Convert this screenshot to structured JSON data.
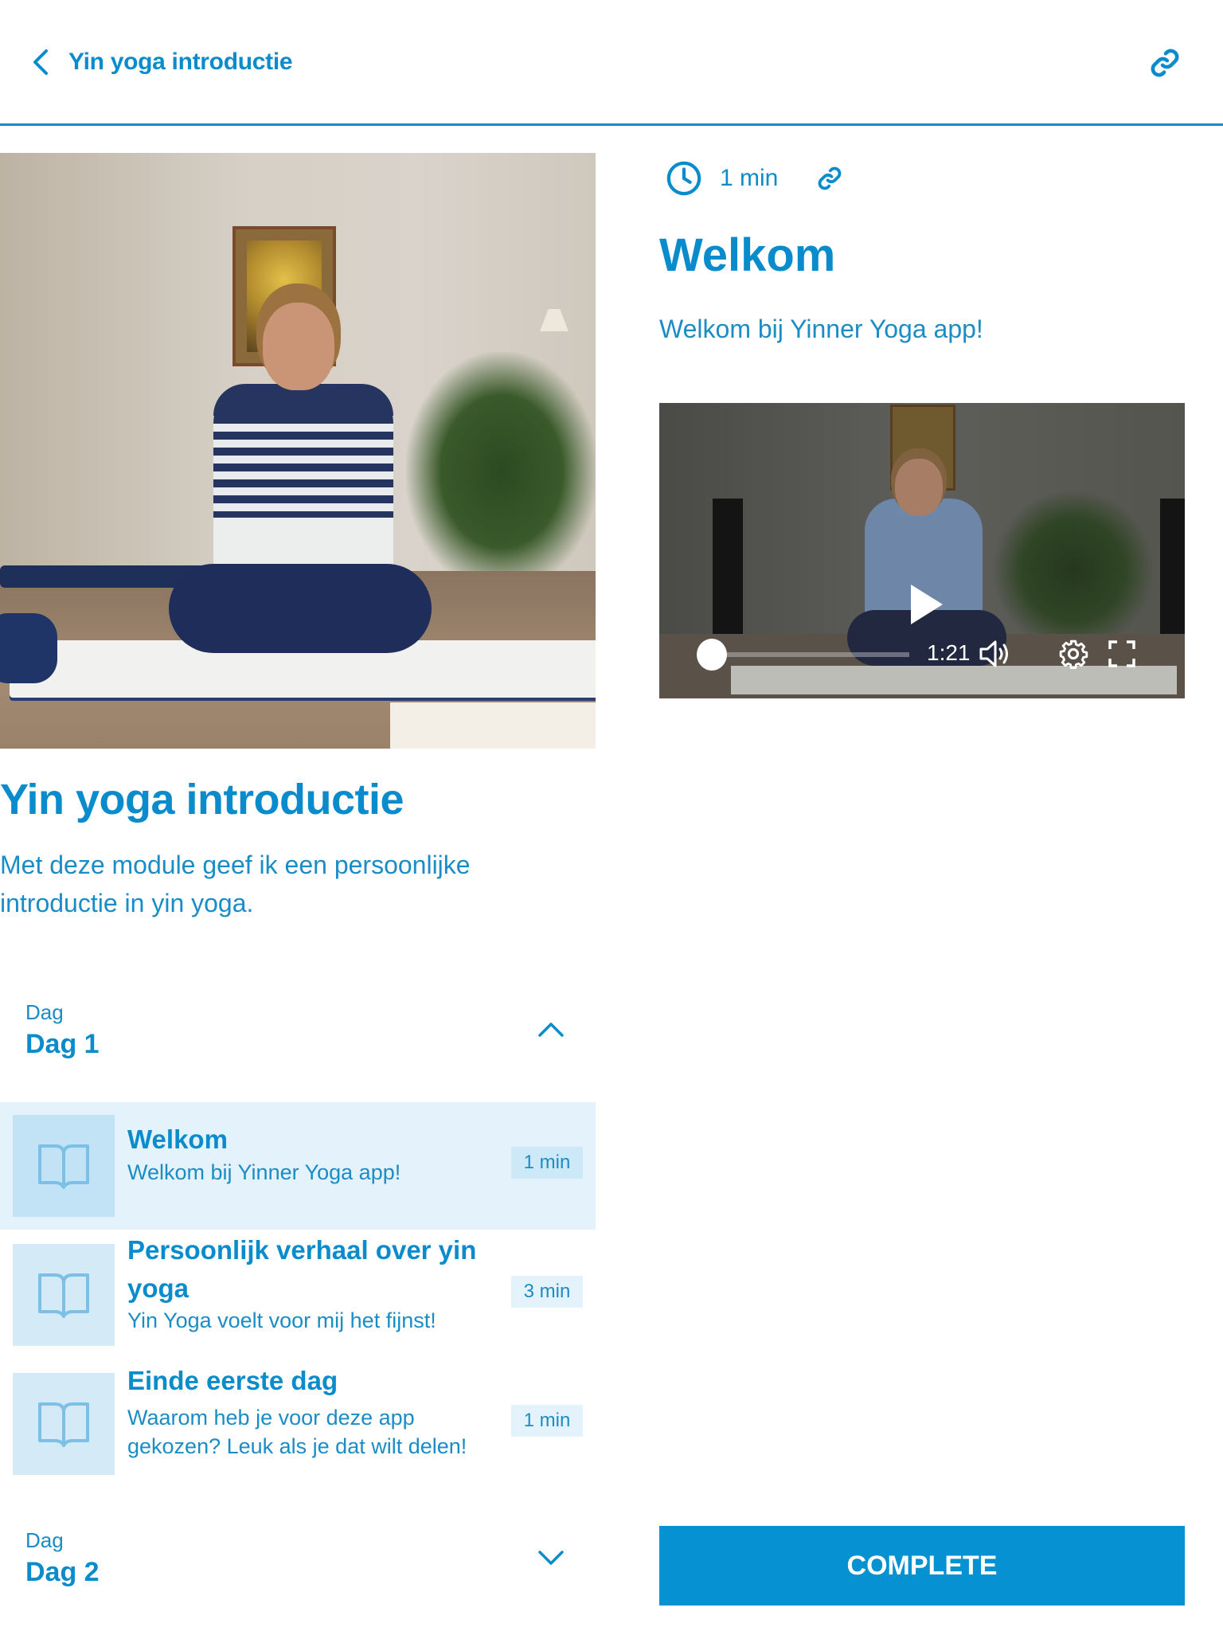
{
  "header": {
    "back_label": "Yin yoga introductie",
    "back_icon": "chevron-left-icon",
    "share_icon": "link-icon"
  },
  "lesson": {
    "duration": "1 min",
    "clock_icon": "clock-icon",
    "link_icon": "link-icon",
    "title": "Welkom",
    "subtitle": "Welkom bij Yinner Yoga app!",
    "video": {
      "time": "1:21",
      "progress_fraction": 0.0,
      "icons": [
        "play-icon",
        "volume-icon",
        "settings-gear-icon",
        "fullscreen-icon"
      ]
    }
  },
  "course": {
    "title": "Yin yoga introductie",
    "description": "Met deze module geef ik een persoonlijke introductie in yin yoga."
  },
  "days": [
    {
      "label": "Dag",
      "name": "Dag 1",
      "expanded": true,
      "lessons": [
        {
          "title": "Welkom",
          "subtitle": "Welkom bij Yinner Yoga app!",
          "duration": "1 min",
          "active": true,
          "icon": "book-open-icon"
        },
        {
          "title": "Persoonlijk verhaal over yin yoga",
          "subtitle": "Yin Yoga voelt voor mij het fijnst!",
          "duration": "3 min",
          "active": false,
          "icon": "book-open-icon"
        },
        {
          "title": "Einde eerste dag",
          "subtitle": "Waarom heb je voor deze app gekozen? Leuk als je dat wilt delen!",
          "duration": "1 min",
          "active": false,
          "icon": "book-open-icon"
        }
      ]
    },
    {
      "label": "Dag",
      "name": "Dag 2",
      "expanded": false,
      "lessons": []
    }
  ],
  "actions": {
    "complete_label": "COMPLETE"
  },
  "colors": {
    "accent": "#0a8ccc",
    "button": "#0591d2",
    "active_row_bg": "#e3f2fb",
    "thumb_bg": "#d4eaf7"
  }
}
